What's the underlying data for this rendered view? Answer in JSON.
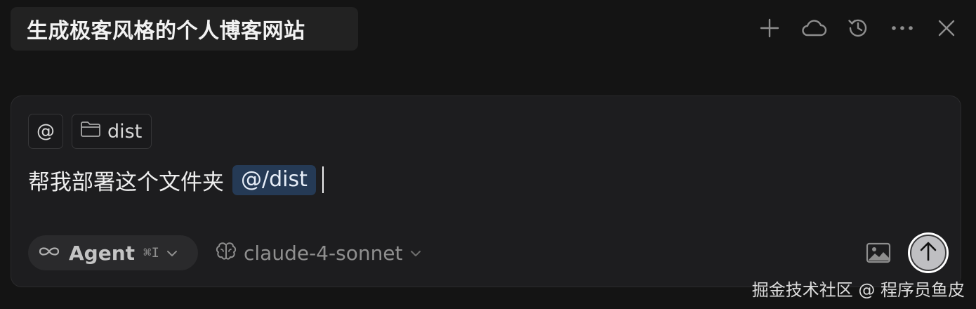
{
  "header": {
    "title": "生成极客风格的个人博客网站",
    "icons": [
      "plus-icon",
      "cloud-icon",
      "history-icon",
      "more-icon",
      "close-icon"
    ]
  },
  "composer": {
    "context_chips": {
      "at_symbol": "@",
      "folder_label": "dist",
      "folder_icon": "folder-icon"
    },
    "input": {
      "text": "帮我部署这个文件夹",
      "mention": "@/dist"
    },
    "mode": {
      "icon": "infinity-icon",
      "label": "Agent",
      "shortcut": "⌘I"
    },
    "model": {
      "icon": "brain-icon",
      "label": "claude-4-sonnet"
    },
    "image_icon": "image-icon",
    "send_icon": "arrow-up-icon"
  },
  "watermark": "掘金技术社区 @ 程序员鱼皮",
  "colors": {
    "background": "#141414",
    "composer_bg": "#1d1d1f",
    "mention_bg": "#253a55",
    "pill_bg": "#2a2a2c"
  }
}
